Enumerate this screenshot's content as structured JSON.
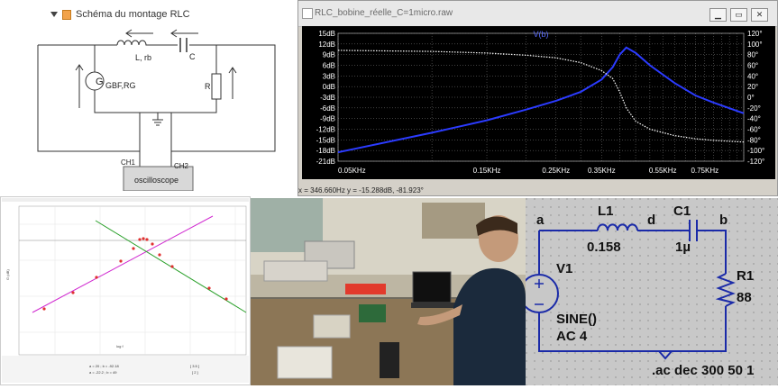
{
  "schematic": {
    "title": "Schéma du montage RLC",
    "inductor_label": "L, rb",
    "capacitor_label": "C",
    "resistor_label": "R",
    "generator_label": "GBF,RG",
    "generator_symbol": "G",
    "ch1_label": "CH1",
    "ch2_label": "CH2",
    "scope_label": "oscilloscope"
  },
  "plot_window": {
    "title": "RLC_bobine_réelle_C=1micro.raw",
    "trace_name": "V(b)",
    "y_left_ticks": [
      "15dB",
      "12dB",
      "9dB",
      "6dB",
      "3dB",
      "0dB",
      "-3dB",
      "-6dB",
      "-9dB",
      "-12dB",
      "-15dB",
      "-18dB",
      "-21dB"
    ],
    "y_right_ticks": [
      "120°",
      "100°",
      "80°",
      "60°",
      "40°",
      "20°",
      "0°",
      "-20°",
      "-40°",
      "-60°",
      "-80°",
      "-100°",
      "-120°"
    ],
    "x_ticks": [
      "0.05KHz",
      "0.15KHz",
      "0.25KHz",
      "0.35KHz",
      "0.55KHz",
      "0.75KHz"
    ],
    "status": "x = 346.660Hz    y = -15.288dB, -81.923°",
    "buttons": {
      "minimize": "▁",
      "restore": "▭",
      "close": "✕"
    },
    "colors": {
      "background": "#000000",
      "magnitude": "#2b3bff",
      "phase": "#ffffff",
      "grid": "#808080"
    }
  },
  "chart_data": {
    "type": "line",
    "title": "V(b)",
    "xlabel": "",
    "ylabel": "",
    "x_scale": "log",
    "xlim": [
      50,
      1000
    ],
    "ylim": [
      -21,
      15
    ],
    "ylim_right": [
      -120,
      120
    ],
    "grid": true,
    "series": [
      {
        "axis": "left",
        "x": [
          50,
          100,
          150,
          200,
          250,
          300,
          350,
          380,
          400,
          420,
          450,
          500,
          600,
          700,
          800,
          1000
        ],
        "y": [
          -18.5,
          -13,
          -9.5,
          -6.5,
          -4,
          -1.5,
          2,
          5.5,
          9,
          11,
          9.5,
          6,
          1,
          -2.5,
          -4.5,
          -7.5
        ]
      },
      {
        "axis": "right",
        "x": [
          50,
          100,
          150,
          200,
          250,
          300,
          350,
          380,
          400,
          420,
          450,
          500,
          600,
          700,
          800,
          1000
        ],
        "y": [
          88,
          86,
          83,
          79,
          74,
          65,
          50,
          35,
          10,
          -20,
          -45,
          -60,
          -72,
          -78,
          -81,
          -84
        ]
      }
    ]
  },
  "regression": {
    "x_label": "log f",
    "y_label": "G (dB)",
    "fit1": "a = 20 ; b = -92.18",
    "fit2": "a = -22.2 ; b = 49",
    "fit1_bracket": "[ 3.5 ]",
    "fit2_bracket": "[ 2 ]",
    "colors": {
      "rising_line": "#d02ad0",
      "falling_line": "#2aa02a",
      "points": "#e03030",
      "row_text": "#c0392b"
    }
  },
  "photo": {
    "colors": {
      "wall": "#d8d4c6",
      "shirt": "#1b2a3c",
      "bench": "#9a7b52"
    }
  },
  "ltspice": {
    "node_a": "a",
    "node_d": "d",
    "node_b": "b",
    "inductor_name": "L1",
    "inductor_value": "0.158",
    "capacitor_name": "C1",
    "capacitor_value": "1µ",
    "resistor_name": "R1",
    "resistor_value": "88",
    "source_name": "V1",
    "source_func": "SINE()",
    "source_ac": "AC 4",
    "directive": ".ac dec 300 50 1"
  }
}
